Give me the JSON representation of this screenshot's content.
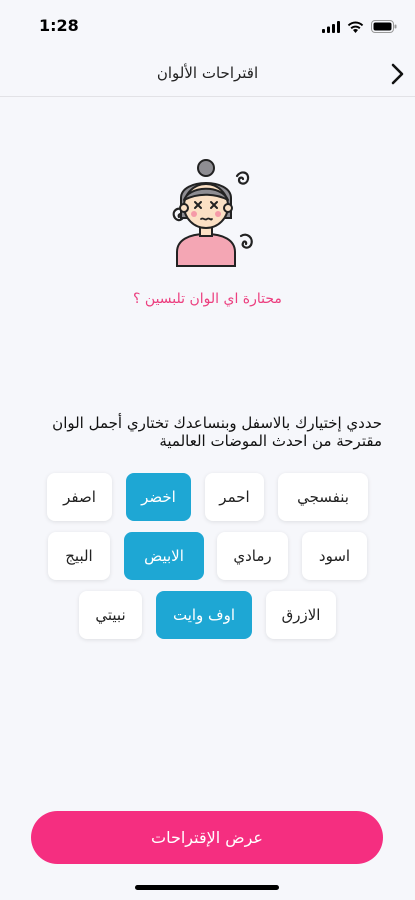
{
  "status_bar": {
    "time": "1:28",
    "icons": [
      "signal-icon",
      "wifi-icon",
      "battery-icon"
    ]
  },
  "nav": {
    "title": "اقتراحات الألوان",
    "back_icon": "chevron-right-icon"
  },
  "illustration": {
    "icon": "confused-girl-illustration"
  },
  "question": "محتارة اي الوان تلبسين ؟",
  "instruction": "حددي إختيارك بالاسفل وبنساعدك تختاري أجمل الوان مقترحة من احدث الموضات العالمية",
  "chips": [
    {
      "label": "بنفسجي",
      "selected": false
    },
    {
      "label": "احمر",
      "selected": false
    },
    {
      "label": "اخضر",
      "selected": true
    },
    {
      "label": "اصفر",
      "selected": false
    },
    {
      "label": "اسود",
      "selected": false
    },
    {
      "label": "رمادي",
      "selected": false
    },
    {
      "label": "الابيض",
      "selected": true
    },
    {
      "label": "البيج",
      "selected": false
    },
    {
      "label": "الازرق",
      "selected": false
    },
    {
      "label": "اوف وايت",
      "selected": true
    },
    {
      "label": "نبيتي",
      "selected": false
    }
  ],
  "cta_label": "عرض الإقتراحات",
  "colors": {
    "accent_pink": "#f52e80",
    "selected_blue": "#1ea7d4",
    "question_pink": "#ec3f7f",
    "background": "#f6f7fb"
  }
}
